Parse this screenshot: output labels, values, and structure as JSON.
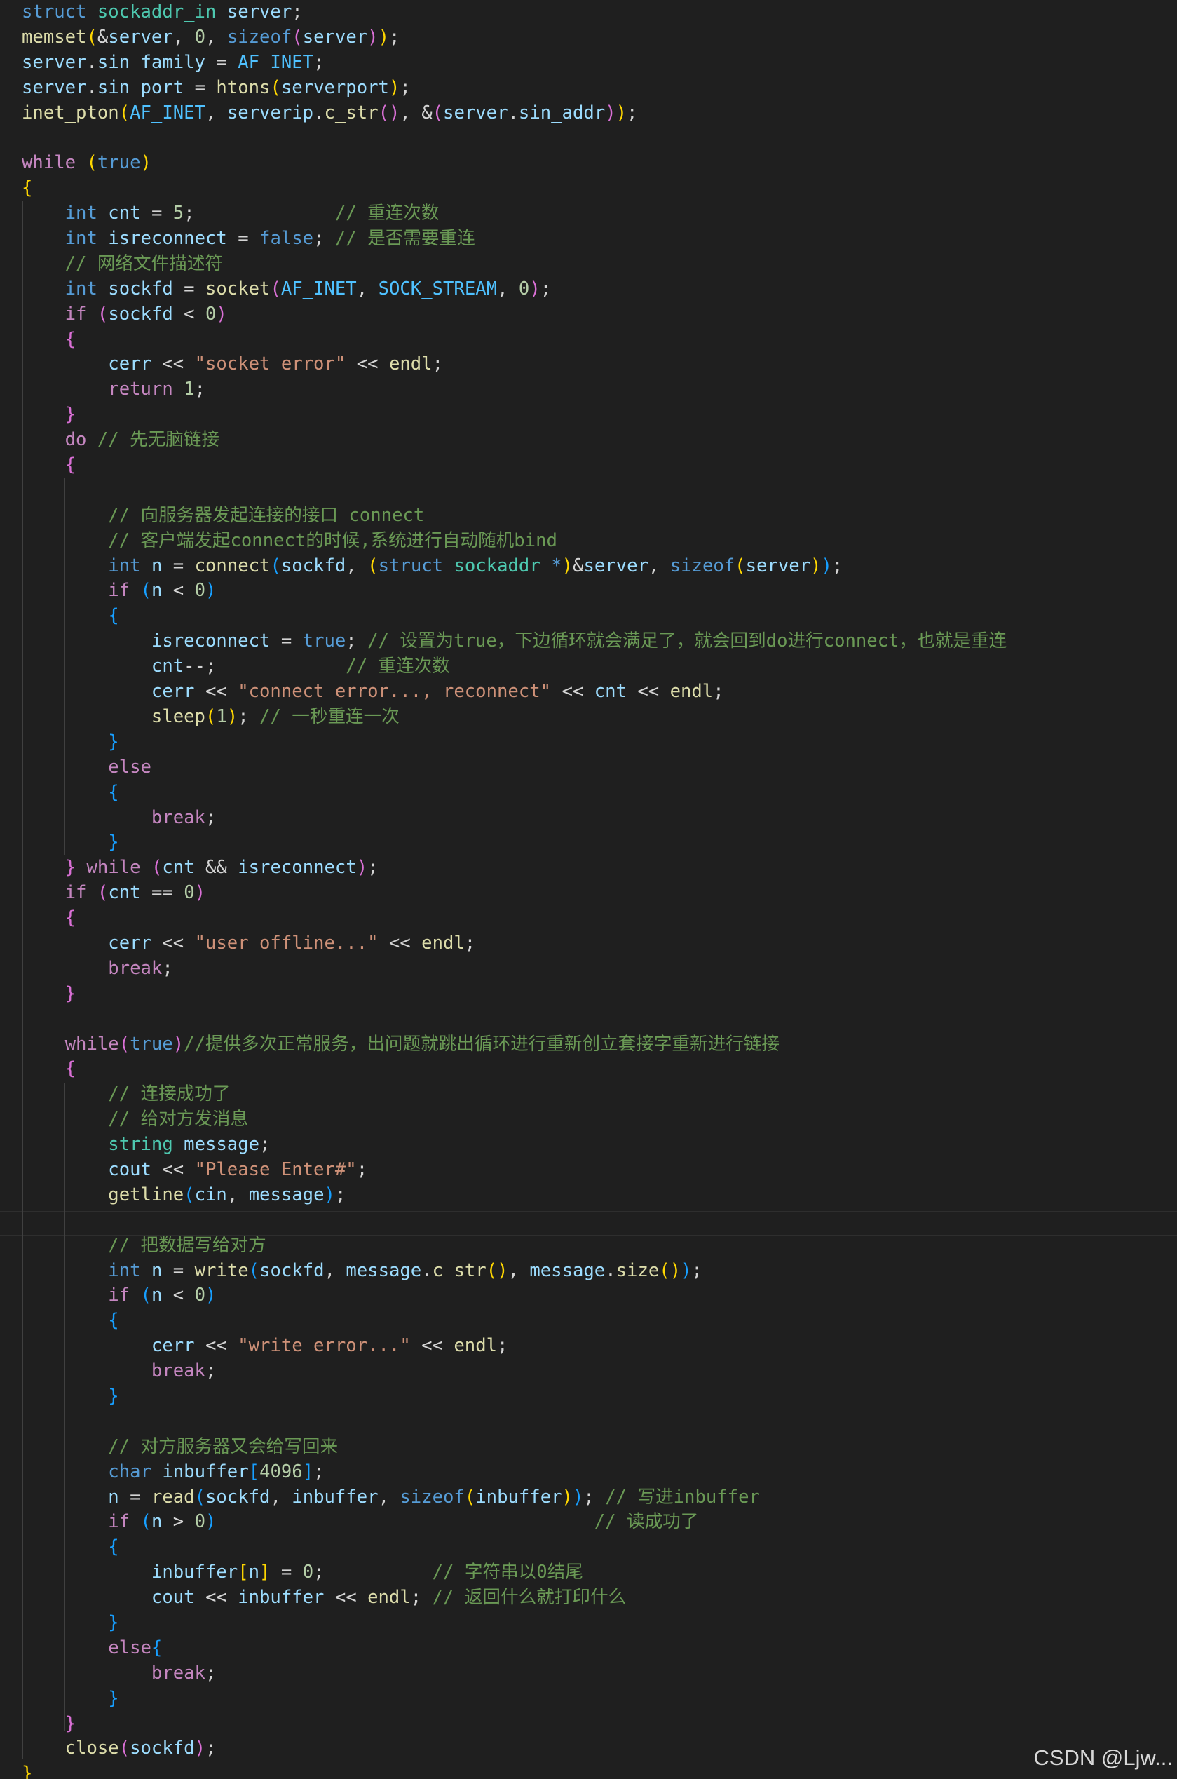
{
  "watermark": "CSDN @Ljw...",
  "code_lines": [
    [
      [
        "kw",
        "struct"
      ],
      [
        "p",
        " "
      ],
      [
        "type",
        "sockaddr_in"
      ],
      [
        "p",
        " "
      ],
      [
        "var",
        "server"
      ],
      [
        "p",
        ";"
      ]
    ],
    [
      [
        "fn",
        "memset"
      ],
      [
        "b1",
        "("
      ],
      [
        "p",
        "&"
      ],
      [
        "var",
        "server"
      ],
      [
        "p",
        ", "
      ],
      [
        "num",
        "0"
      ],
      [
        "p",
        ", "
      ],
      [
        "kw",
        "sizeof"
      ],
      [
        "b2",
        "("
      ],
      [
        "var",
        "server"
      ],
      [
        "b2",
        ")"
      ],
      [
        "b1",
        ")"
      ],
      [
        "p",
        ";"
      ]
    ],
    [
      [
        "var",
        "server"
      ],
      [
        "p",
        "."
      ],
      [
        "var",
        "sin_family"
      ],
      [
        "p",
        " = "
      ],
      [
        "cst",
        "AF_INET"
      ],
      [
        "p",
        ";"
      ]
    ],
    [
      [
        "var",
        "server"
      ],
      [
        "p",
        "."
      ],
      [
        "var",
        "sin_port"
      ],
      [
        "p",
        " = "
      ],
      [
        "fn",
        "htons"
      ],
      [
        "b1",
        "("
      ],
      [
        "var",
        "serverport"
      ],
      [
        "b1",
        ")"
      ],
      [
        "p",
        ";"
      ]
    ],
    [
      [
        "fn",
        "inet_pton"
      ],
      [
        "b1",
        "("
      ],
      [
        "cst",
        "AF_INET"
      ],
      [
        "p",
        ", "
      ],
      [
        "var",
        "serverip"
      ],
      [
        "p",
        "."
      ],
      [
        "fn",
        "c_str"
      ],
      [
        "b2",
        "()"
      ],
      [
        "p",
        ", &"
      ],
      [
        "b2",
        "("
      ],
      [
        "var",
        "server"
      ],
      [
        "p",
        "."
      ],
      [
        "var",
        "sin_addr"
      ],
      [
        "b2",
        ")"
      ],
      [
        "b1",
        ")"
      ],
      [
        "p",
        ";"
      ]
    ],
    [],
    [
      [
        "ctl",
        "while"
      ],
      [
        "p",
        " "
      ],
      [
        "b1",
        "("
      ],
      [
        "kw",
        "true"
      ],
      [
        "b1",
        ")"
      ]
    ],
    [
      [
        "b1",
        "{"
      ]
    ],
    [
      [
        "p",
        "    "
      ],
      [
        "kw",
        "int"
      ],
      [
        "p",
        " "
      ],
      [
        "var",
        "cnt"
      ],
      [
        "p",
        " = "
      ],
      [
        "num",
        "5"
      ],
      [
        "p",
        ";             "
      ],
      [
        "cmt",
        "// 重连次数"
      ]
    ],
    [
      [
        "p",
        "    "
      ],
      [
        "kw",
        "int"
      ],
      [
        "p",
        " "
      ],
      [
        "var",
        "isreconnect"
      ],
      [
        "p",
        " = "
      ],
      [
        "kw",
        "false"
      ],
      [
        "p",
        "; "
      ],
      [
        "cmt",
        "// 是否需要重连"
      ]
    ],
    [
      [
        "p",
        "    "
      ],
      [
        "cmt",
        "// 网络文件描述符"
      ]
    ],
    [
      [
        "p",
        "    "
      ],
      [
        "kw",
        "int"
      ],
      [
        "p",
        " "
      ],
      [
        "var",
        "sockfd"
      ],
      [
        "p",
        " = "
      ],
      [
        "fn",
        "socket"
      ],
      [
        "b2",
        "("
      ],
      [
        "cst",
        "AF_INET"
      ],
      [
        "p",
        ", "
      ],
      [
        "cst",
        "SOCK_STREAM"
      ],
      [
        "p",
        ", "
      ],
      [
        "num",
        "0"
      ],
      [
        "b2",
        ")"
      ],
      [
        "p",
        ";"
      ]
    ],
    [
      [
        "p",
        "    "
      ],
      [
        "ctl",
        "if"
      ],
      [
        "p",
        " "
      ],
      [
        "b2",
        "("
      ],
      [
        "var",
        "sockfd"
      ],
      [
        "p",
        " < "
      ],
      [
        "num",
        "0"
      ],
      [
        "b2",
        ")"
      ]
    ],
    [
      [
        "p",
        "    "
      ],
      [
        "b2",
        "{"
      ]
    ],
    [
      [
        "p",
        "        "
      ],
      [
        "var",
        "cerr"
      ],
      [
        "p",
        " << "
      ],
      [
        "str",
        "\"socket error\""
      ],
      [
        "p",
        " << "
      ],
      [
        "fn",
        "endl"
      ],
      [
        "p",
        ";"
      ]
    ],
    [
      [
        "p",
        "        "
      ],
      [
        "ctl",
        "return"
      ],
      [
        "p",
        " "
      ],
      [
        "num",
        "1"
      ],
      [
        "p",
        ";"
      ]
    ],
    [
      [
        "p",
        "    "
      ],
      [
        "b2",
        "}"
      ]
    ],
    [
      [
        "p",
        "    "
      ],
      [
        "ctl",
        "do"
      ],
      [
        "p",
        " "
      ],
      [
        "cmt",
        "// 先无脑链接"
      ]
    ],
    [
      [
        "p",
        "    "
      ],
      [
        "b2",
        "{"
      ]
    ],
    [],
    [
      [
        "p",
        "        "
      ],
      [
        "cmt",
        "// 向服务器发起连接的接口 connect"
      ]
    ],
    [
      [
        "p",
        "        "
      ],
      [
        "cmt",
        "// 客户端发起connect的时候,系统进行自动随机bind"
      ]
    ],
    [
      [
        "p",
        "        "
      ],
      [
        "kw",
        "int"
      ],
      [
        "p",
        " "
      ],
      [
        "var",
        "n"
      ],
      [
        "p",
        " = "
      ],
      [
        "fn",
        "connect"
      ],
      [
        "b3",
        "("
      ],
      [
        "var",
        "sockfd"
      ],
      [
        "p",
        ", "
      ],
      [
        "b1",
        "("
      ],
      [
        "kw",
        "struct"
      ],
      [
        "p",
        " "
      ],
      [
        "type",
        "sockaddr"
      ],
      [
        "p",
        " "
      ],
      [
        "kw",
        "*"
      ],
      [
        "b1",
        ")"
      ],
      [
        "p",
        "&"
      ],
      [
        "var",
        "server"
      ],
      [
        "p",
        ", "
      ],
      [
        "kw",
        "sizeof"
      ],
      [
        "b1",
        "("
      ],
      [
        "var",
        "server"
      ],
      [
        "b1",
        ")"
      ],
      [
        "b3",
        ")"
      ],
      [
        "p",
        ";"
      ]
    ],
    [
      [
        "p",
        "        "
      ],
      [
        "ctl",
        "if"
      ],
      [
        "p",
        " "
      ],
      [
        "b3",
        "("
      ],
      [
        "var",
        "n"
      ],
      [
        "p",
        " < "
      ],
      [
        "num",
        "0"
      ],
      [
        "b3",
        ")"
      ]
    ],
    [
      [
        "p",
        "        "
      ],
      [
        "b3",
        "{"
      ]
    ],
    [
      [
        "p",
        "            "
      ],
      [
        "var",
        "isreconnect"
      ],
      [
        "p",
        " = "
      ],
      [
        "kw",
        "true"
      ],
      [
        "p",
        "; "
      ],
      [
        "cmt",
        "// 设置为true，下边循环就会满足了，就会回到do进行connect，也就是重连"
      ]
    ],
    [
      [
        "p",
        "            "
      ],
      [
        "var",
        "cnt"
      ],
      [
        "p",
        "--;            "
      ],
      [
        "cmt",
        "// 重连次数"
      ]
    ],
    [
      [
        "p",
        "            "
      ],
      [
        "var",
        "cerr"
      ],
      [
        "p",
        " << "
      ],
      [
        "str",
        "\"connect error..., reconnect\""
      ],
      [
        "p",
        " << "
      ],
      [
        "var",
        "cnt"
      ],
      [
        "p",
        " << "
      ],
      [
        "fn",
        "endl"
      ],
      [
        "p",
        ";"
      ]
    ],
    [
      [
        "p",
        "            "
      ],
      [
        "fn",
        "sleep"
      ],
      [
        "b1",
        "("
      ],
      [
        "num",
        "1"
      ],
      [
        "b1",
        ")"
      ],
      [
        "p",
        "; "
      ],
      [
        "cmt",
        "// 一秒重连一次"
      ]
    ],
    [
      [
        "p",
        "        "
      ],
      [
        "b3",
        "}"
      ]
    ],
    [
      [
        "p",
        "        "
      ],
      [
        "ctl",
        "else"
      ]
    ],
    [
      [
        "p",
        "        "
      ],
      [
        "b3",
        "{"
      ]
    ],
    [
      [
        "p",
        "            "
      ],
      [
        "ctl",
        "break"
      ],
      [
        "p",
        ";"
      ]
    ],
    [
      [
        "p",
        "        "
      ],
      [
        "b3",
        "}"
      ]
    ],
    [
      [
        "p",
        "    "
      ],
      [
        "b2",
        "}"
      ],
      [
        "p",
        " "
      ],
      [
        "ctl",
        "while"
      ],
      [
        "p",
        " "
      ],
      [
        "b2",
        "("
      ],
      [
        "var",
        "cnt"
      ],
      [
        "p",
        " && "
      ],
      [
        "var",
        "isreconnect"
      ],
      [
        "b2",
        ")"
      ],
      [
        "p",
        ";"
      ]
    ],
    [
      [
        "p",
        "    "
      ],
      [
        "ctl",
        "if"
      ],
      [
        "p",
        " "
      ],
      [
        "b2",
        "("
      ],
      [
        "var",
        "cnt"
      ],
      [
        "p",
        " == "
      ],
      [
        "num",
        "0"
      ],
      [
        "b2",
        ")"
      ]
    ],
    [
      [
        "p",
        "    "
      ],
      [
        "b2",
        "{"
      ]
    ],
    [
      [
        "p",
        "        "
      ],
      [
        "var",
        "cerr"
      ],
      [
        "p",
        " << "
      ],
      [
        "str",
        "\"user offline...\""
      ],
      [
        "p",
        " << "
      ],
      [
        "fn",
        "endl"
      ],
      [
        "p",
        ";"
      ]
    ],
    [
      [
        "p",
        "        "
      ],
      [
        "ctl",
        "break"
      ],
      [
        "p",
        ";"
      ]
    ],
    [
      [
        "p",
        "    "
      ],
      [
        "b2",
        "}"
      ]
    ],
    [],
    [
      [
        "p",
        "    "
      ],
      [
        "ctl",
        "while"
      ],
      [
        "b2",
        "("
      ],
      [
        "kw",
        "true"
      ],
      [
        "b2",
        ")"
      ],
      [
        "cmt",
        "//提供多次正常服务，出问题就跳出循环进行重新创立套接字重新进行链接"
      ]
    ],
    [
      [
        "p",
        "    "
      ],
      [
        "b2",
        "{"
      ]
    ],
    [
      [
        "p",
        "        "
      ],
      [
        "cmt",
        "// 连接成功了"
      ]
    ],
    [
      [
        "p",
        "        "
      ],
      [
        "cmt",
        "// 给对方发消息"
      ]
    ],
    [
      [
        "p",
        "        "
      ],
      [
        "type",
        "string"
      ],
      [
        "p",
        " "
      ],
      [
        "var",
        "message"
      ],
      [
        "p",
        ";"
      ]
    ],
    [
      [
        "p",
        "        "
      ],
      [
        "var",
        "cout"
      ],
      [
        "p",
        " << "
      ],
      [
        "str",
        "\"Please Enter#\""
      ],
      [
        "p",
        ";"
      ]
    ],
    [
      [
        "p",
        "        "
      ],
      [
        "fn",
        "getline"
      ],
      [
        "b3",
        "("
      ],
      [
        "var",
        "cin"
      ],
      [
        "p",
        ", "
      ],
      [
        "var",
        "message"
      ],
      [
        "b3",
        ")"
      ],
      [
        "p",
        ";"
      ]
    ],
    [],
    [
      [
        "p",
        "        "
      ],
      [
        "cmt",
        "// 把数据写给对方"
      ]
    ],
    [
      [
        "p",
        "        "
      ],
      [
        "kw",
        "int"
      ],
      [
        "p",
        " "
      ],
      [
        "var",
        "n"
      ],
      [
        "p",
        " = "
      ],
      [
        "fn",
        "write"
      ],
      [
        "b3",
        "("
      ],
      [
        "var",
        "sockfd"
      ],
      [
        "p",
        ", "
      ],
      [
        "var",
        "message"
      ],
      [
        "p",
        "."
      ],
      [
        "fn",
        "c_str"
      ],
      [
        "b1",
        "()"
      ],
      [
        "p",
        ", "
      ],
      [
        "var",
        "message"
      ],
      [
        "p",
        "."
      ],
      [
        "fn",
        "size"
      ],
      [
        "b1",
        "()"
      ],
      [
        "b3",
        ")"
      ],
      [
        "p",
        ";"
      ]
    ],
    [
      [
        "p",
        "        "
      ],
      [
        "ctl",
        "if"
      ],
      [
        "p",
        " "
      ],
      [
        "b3",
        "("
      ],
      [
        "var",
        "n"
      ],
      [
        "p",
        " < "
      ],
      [
        "num",
        "0"
      ],
      [
        "b3",
        ")"
      ]
    ],
    [
      [
        "p",
        "        "
      ],
      [
        "b3",
        "{"
      ]
    ],
    [
      [
        "p",
        "            "
      ],
      [
        "var",
        "cerr"
      ],
      [
        "p",
        " << "
      ],
      [
        "str",
        "\"write error...\""
      ],
      [
        "p",
        " << "
      ],
      [
        "fn",
        "endl"
      ],
      [
        "p",
        ";"
      ]
    ],
    [
      [
        "p",
        "            "
      ],
      [
        "ctl",
        "break"
      ],
      [
        "p",
        ";"
      ]
    ],
    [
      [
        "p",
        "        "
      ],
      [
        "b3",
        "}"
      ]
    ],
    [],
    [
      [
        "p",
        "        "
      ],
      [
        "cmt",
        "// 对方服务器又会给写回来"
      ]
    ],
    [
      [
        "p",
        "        "
      ],
      [
        "kw",
        "char"
      ],
      [
        "p",
        " "
      ],
      [
        "var",
        "inbuffer"
      ],
      [
        "b3",
        "["
      ],
      [
        "num",
        "4096"
      ],
      [
        "b3",
        "]"
      ],
      [
        "p",
        ";"
      ]
    ],
    [
      [
        "p",
        "        "
      ],
      [
        "var",
        "n"
      ],
      [
        "p",
        " = "
      ],
      [
        "fn",
        "read"
      ],
      [
        "b3",
        "("
      ],
      [
        "var",
        "sockfd"
      ],
      [
        "p",
        ", "
      ],
      [
        "var",
        "inbuffer"
      ],
      [
        "p",
        ", "
      ],
      [
        "kw",
        "sizeof"
      ],
      [
        "b1",
        "("
      ],
      [
        "var",
        "inbuffer"
      ],
      [
        "b1",
        ")"
      ],
      [
        "b3",
        ")"
      ],
      [
        "p",
        "; "
      ],
      [
        "cmt",
        "// 写进inbuffer"
      ]
    ],
    [
      [
        "p",
        "        "
      ],
      [
        "ctl",
        "if"
      ],
      [
        "p",
        " "
      ],
      [
        "b3",
        "("
      ],
      [
        "var",
        "n"
      ],
      [
        "p",
        " > "
      ],
      [
        "num",
        "0"
      ],
      [
        "b3",
        ")"
      ],
      [
        "p",
        "                                   "
      ],
      [
        "cmt",
        "// 读成功了"
      ]
    ],
    [
      [
        "p",
        "        "
      ],
      [
        "b3",
        "{"
      ]
    ],
    [
      [
        "p",
        "            "
      ],
      [
        "var",
        "inbuffer"
      ],
      [
        "b1",
        "["
      ],
      [
        "var",
        "n"
      ],
      [
        "b1",
        "]"
      ],
      [
        "p",
        " = "
      ],
      [
        "num",
        "0"
      ],
      [
        "p",
        ";          "
      ],
      [
        "cmt",
        "// 字符串以0结尾"
      ]
    ],
    [
      [
        "p",
        "            "
      ],
      [
        "var",
        "cout"
      ],
      [
        "p",
        " << "
      ],
      [
        "var",
        "inbuffer"
      ],
      [
        "p",
        " << "
      ],
      [
        "fn",
        "endl"
      ],
      [
        "p",
        "; "
      ],
      [
        "cmt",
        "// 返回什么就打印什么"
      ]
    ],
    [
      [
        "p",
        "        "
      ],
      [
        "b3",
        "}"
      ]
    ],
    [
      [
        "p",
        "        "
      ],
      [
        "ctl",
        "else"
      ],
      [
        "b3",
        "{"
      ]
    ],
    [
      [
        "p",
        "            "
      ],
      [
        "ctl",
        "break"
      ],
      [
        "p",
        ";"
      ]
    ],
    [
      [
        "p",
        "        "
      ],
      [
        "b3",
        "}"
      ]
    ],
    [
      [
        "p",
        "    "
      ],
      [
        "b2",
        "}"
      ]
    ],
    [
      [
        "p",
        "    "
      ],
      [
        "fn",
        "close"
      ],
      [
        "b2",
        "("
      ],
      [
        "var",
        "sockfd"
      ],
      [
        "b2",
        ")"
      ],
      [
        "p",
        ";"
      ]
    ],
    [
      [
        "b1",
        "}"
      ]
    ]
  ]
}
